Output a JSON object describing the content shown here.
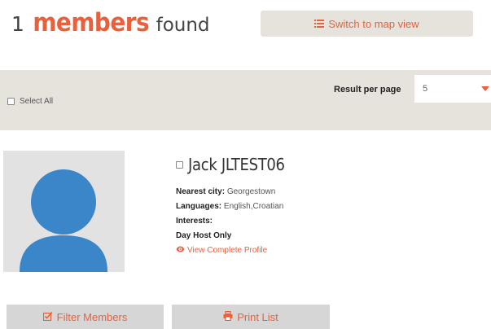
{
  "header": {
    "count": "1",
    "members_word": "members",
    "found_word": "found",
    "switch_button_label": "Switch to map view",
    "switch_button_icon": "list-icon"
  },
  "toolbar": {
    "select_all_label": "Select All",
    "result_per_page_label": "Result per page",
    "result_per_page_value": "5"
  },
  "member": {
    "name": "Jack JLTEST06",
    "nearest_city_label": "Nearest city:",
    "nearest_city_value": "Georgestown",
    "languages_label": "Languages:",
    "languages_value": "English,Croatian",
    "interests_label": "Interests:",
    "interests_value": "",
    "day_host": "Day Host Only",
    "view_profile_label": "View Complete Profile",
    "view_profile_icon": "eye-icon"
  },
  "footer": {
    "filter_label": "Filter Members",
    "filter_icon": "checkbox-edit-icon",
    "print_label": "Print List",
    "print_icon": "printer-icon"
  },
  "colors": {
    "accent": "#e8603c",
    "toolbar_bg": "#e6e2dc",
    "avatar_bg": "#e2e2e2",
    "avatar_figure": "#3a86c8",
    "button_bg": "#d6d6d6"
  }
}
